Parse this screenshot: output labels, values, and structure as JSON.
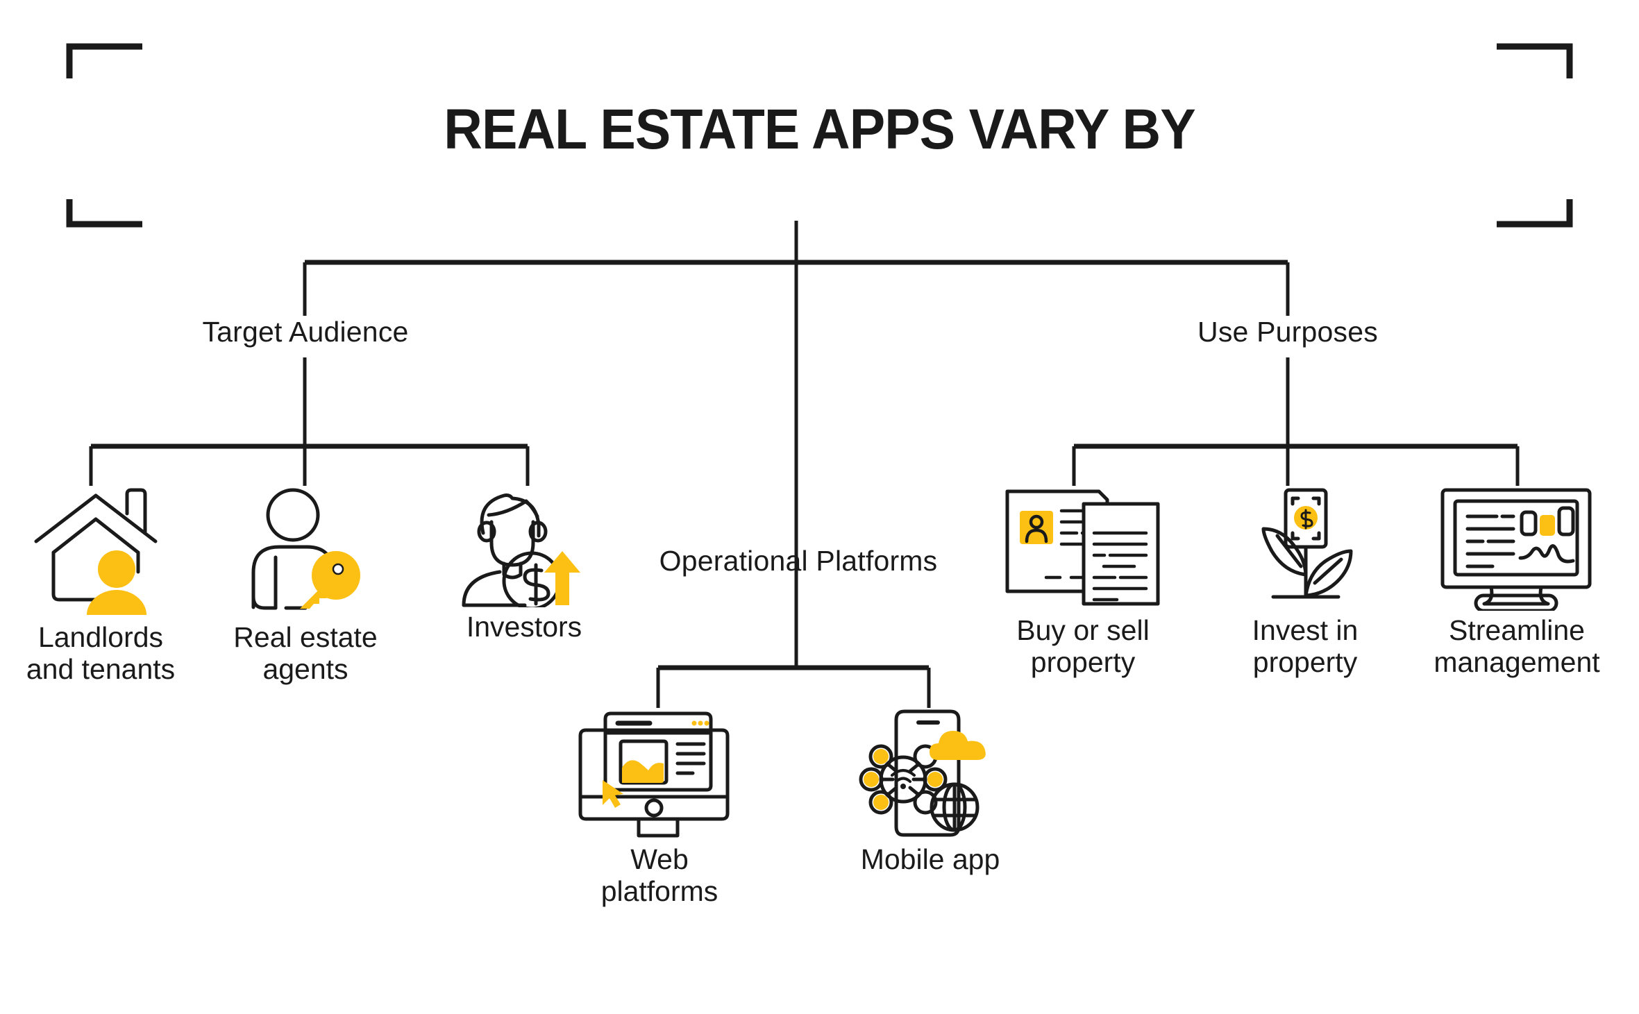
{
  "page": {
    "title": "REAL ESTATE APPS VARY BY",
    "background_color": "#FFFFFF",
    "accent_color": "#FBC013",
    "line_color": "#1A1A1A"
  },
  "frame": {
    "corner_top_left": "corner-bracket",
    "corner_top_right": "corner-bracket",
    "corner_bottom_left": "corner-bracket",
    "corner_bottom_right": "corner-bracket"
  },
  "chart_data": {
    "type": "tree-diagram",
    "title": "REAL ESTATE APPS VARY BY",
    "root": "REAL ESTATE APPS VARY BY",
    "branches": [
      {
        "label": "Target Audience",
        "position": "left",
        "children": [
          "Landlords and tenants",
          "Real estate agents",
          "Investors"
        ]
      },
      {
        "label": "Operational Platforms",
        "position": "center",
        "children": [
          "Web platforms",
          "Mobile app"
        ]
      },
      {
        "label": "Use Purposes",
        "position": "right",
        "children": [
          "Buy or sell property",
          "Invest in property",
          "Streamline management"
        ]
      }
    ]
  },
  "branches": {
    "target_audience": {
      "label": "Target Audience"
    },
    "operational_platforms": {
      "label": "Operational Platforms"
    },
    "use_purposes": {
      "label": "Use Purposes"
    }
  },
  "leaves": {
    "landlords": {
      "label": "Landlords\nand tenants",
      "icon": "house-person-icon"
    },
    "agents": {
      "label": "Real estate\nagents",
      "icon": "person-key-icon"
    },
    "investors": {
      "label": "Investors",
      "icon": "person-dollar-arrow-icon"
    },
    "web": {
      "label": "Web\nplatforms",
      "icon": "desktop-browser-icon"
    },
    "mobile": {
      "label": "Mobile app",
      "icon": "phone-network-cloud-icon"
    },
    "buysell": {
      "label": "Buy or sell\nproperty",
      "icon": "documents-contract-icon"
    },
    "invest": {
      "label": "Invest in\nproperty",
      "icon": "money-plant-icon"
    },
    "streamline": {
      "label": "Streamline\nmanagement",
      "icon": "monitor-dashboard-icon"
    }
  }
}
